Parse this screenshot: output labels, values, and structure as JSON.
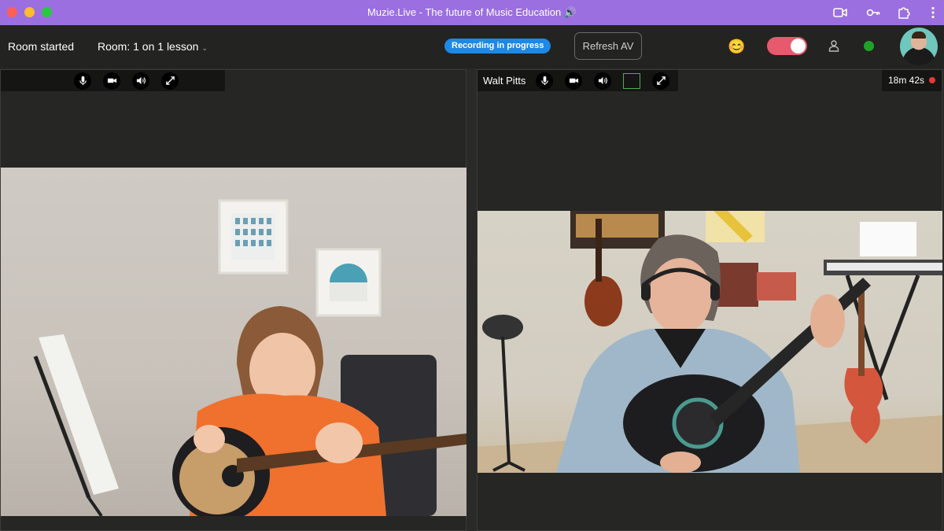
{
  "window": {
    "title": "Muzie.Live - The future of Music Education 🔊"
  },
  "header": {
    "room_status": "Room started",
    "room_name": "Room: 1 on 1 lesson",
    "recording_badge": "Recording in progress",
    "refresh_button": "Refresh AV",
    "emoji": "😊",
    "toggle_on": true
  },
  "videos": {
    "left": {
      "participant_name": ""
    },
    "right": {
      "participant_name": "Walt Pitts",
      "elapsed_time": "18m 42s"
    }
  },
  "colors": {
    "titlebar": "#9b6fe0",
    "recording_badge": "#1e88e5",
    "toggle": "#e8596e",
    "status_dot": "#1fa326",
    "record_dot": "#e53935"
  }
}
